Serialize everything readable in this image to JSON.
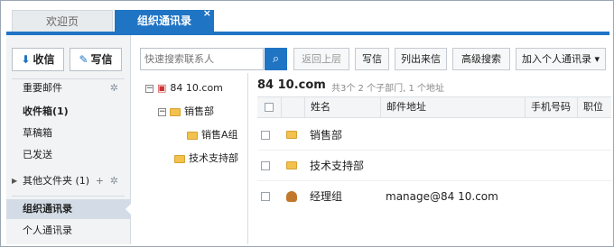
{
  "tabs": [
    {
      "label": "欢迎页"
    },
    {
      "label": "组织通讯录",
      "close": "×"
    }
  ],
  "sidebar": {
    "receive_label": "收信",
    "write_label": "写信",
    "items": [
      {
        "label": "重要邮件"
      },
      {
        "label": "收件箱(1)"
      },
      {
        "label": "草稿箱"
      },
      {
        "label": "已发送"
      },
      {
        "label": "其他文件夹 (1)"
      },
      {
        "label": "组织通讯录"
      },
      {
        "label": "个人通讯录"
      }
    ]
  },
  "toolbar": {
    "search_placeholder": "快速搜索联系人",
    "buttons": [
      "返回上层",
      "写信",
      "列出来信",
      "高级搜索",
      "加入个人通讯录 ▾"
    ]
  },
  "tree": {
    "root": {
      "pre": "84",
      "mid": "   ",
      "post": "10.com"
    },
    "nodes": [
      "销售部",
      "销售A组",
      "技术支持部"
    ]
  },
  "main": {
    "domain": {
      "pre": "84",
      "mid": "   ",
      "post": "10.com"
    },
    "summary": "共3个 2 个子部门, 1 个地址",
    "columns": [
      "姓名",
      "邮件地址",
      "手机号码",
      "职位"
    ],
    "rows": [
      {
        "name": "销售部",
        "email_pre": "",
        "email_mid": "",
        "email_post": "",
        "type": "folder"
      },
      {
        "name": "技术支持部",
        "email_pre": "",
        "email_mid": "",
        "email_post": "",
        "type": "folder"
      },
      {
        "name": "经理组",
        "email_pre": "manage@84",
        "email_mid": "   ",
        "email_post": "10.com",
        "type": "person"
      }
    ]
  },
  "colors": {
    "accent": "#1f74c4",
    "folder": "#f2c14e"
  },
  "icons": {
    "receive": "download-icon",
    "write": "compose-icon",
    "search": "search-icon",
    "settings": "gear-icon"
  }
}
